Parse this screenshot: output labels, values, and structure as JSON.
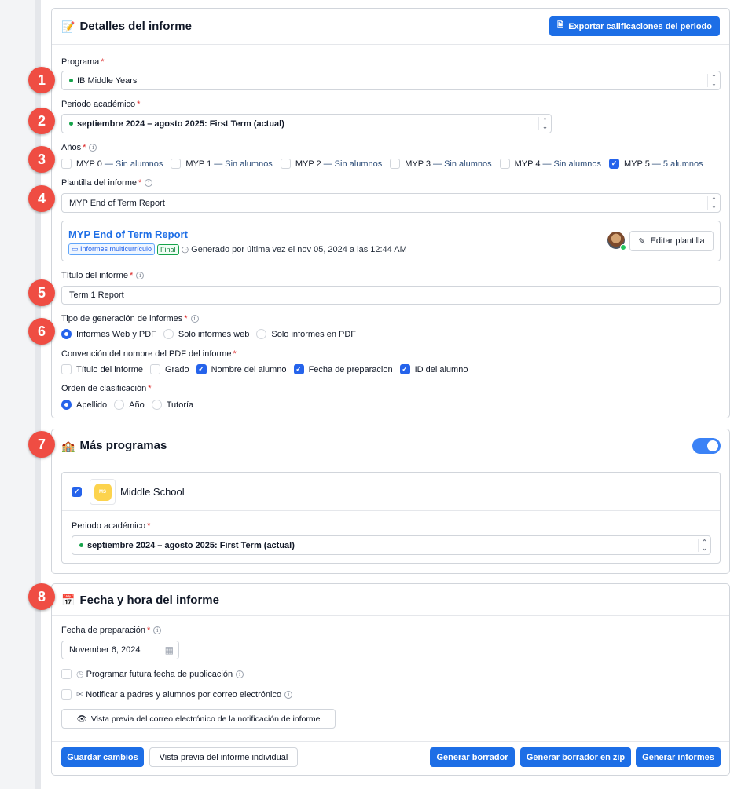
{
  "details": {
    "title": "Detalles del informe",
    "export_label": "Exportar calificaciones del periodo",
    "programa_label": "Programa",
    "programa_value": "IB Middle Years",
    "periodo_label": "Periodo académico",
    "periodo_value": "septiembre 2024 – agosto 2025: First Term (actual)",
    "anios_label": "Años",
    "years": [
      {
        "label": "MYP 0",
        "note": "— Sin alumnos",
        "checked": false
      },
      {
        "label": "MYP 1",
        "note": "— Sin alumnos",
        "checked": false
      },
      {
        "label": "MYP 2",
        "note": "— Sin alumnos",
        "checked": false
      },
      {
        "label": "MYP 3",
        "note": "— Sin alumnos",
        "checked": false
      },
      {
        "label": "MYP 4",
        "note": "— Sin alumnos",
        "checked": false
      },
      {
        "label": "MYP 5",
        "note": "— 5 alumnos",
        "checked": true
      }
    ],
    "plantilla_label": "Plantilla del informe",
    "plantilla_value": "MYP End of Term Report",
    "template_card": {
      "name": "MYP End of Term Report",
      "tag1": "Informes multicurrículo",
      "tag2": "Final",
      "generated": "Generado por última vez el nov 05, 2024 a las 12:44 AM",
      "edit_label": "Editar plantilla"
    },
    "titulo_label": "Título del informe",
    "titulo_value": "Term 1 Report",
    "tipo_label": "Tipo de generación de informes",
    "tipo_options": [
      {
        "label": "Informes Web y PDF",
        "selected": true
      },
      {
        "label": "Solo informes web",
        "selected": false
      },
      {
        "label": "Solo informes en PDF",
        "selected": false
      }
    ],
    "convencion_label": "Convención del nombre del PDF del informe",
    "convencion_options": [
      {
        "label": "Título del informe",
        "checked": false
      },
      {
        "label": "Grado",
        "checked": false
      },
      {
        "label": "Nombre del alumno",
        "checked": true
      },
      {
        "label": "Fecha de preparacion",
        "checked": true
      },
      {
        "label": "ID del alumno",
        "checked": true
      }
    ],
    "orden_label": "Orden de clasificación",
    "orden_options": [
      {
        "label": "Apellido",
        "selected": true
      },
      {
        "label": "Año",
        "selected": false
      },
      {
        "label": "Tutoría",
        "selected": false
      }
    ]
  },
  "more": {
    "title": "Más programas",
    "toggle_on": true,
    "program_name": "Middle School",
    "program_logo": "MS",
    "periodo_label": "Periodo académico",
    "periodo_value": "septiembre 2024 – agosto 2025: First Term (actual)"
  },
  "datetime": {
    "title": "Fecha y hora del informe",
    "fecha_label": "Fecha de preparación",
    "fecha_value": "November 6, 2024",
    "schedule_label": "Programar futura fecha de publicación",
    "notify_label": "Notificar a padres y alumnos por correo electrónico",
    "preview_email_label": "Vista previa del correo electrónico de la notificación de informe"
  },
  "footer": {
    "save": "Guardar cambios",
    "preview": "Vista previa del informe individual",
    "draft": "Generar borrador",
    "draft_zip": "Generar borrador en zip",
    "generate": "Generar informes"
  },
  "badges": [
    "1",
    "2",
    "3",
    "4",
    "5",
    "6",
    "7",
    "8"
  ],
  "colors": {
    "primary": "#1d6ee6",
    "badge": "#ef4d43",
    "required": "#dc2626"
  }
}
